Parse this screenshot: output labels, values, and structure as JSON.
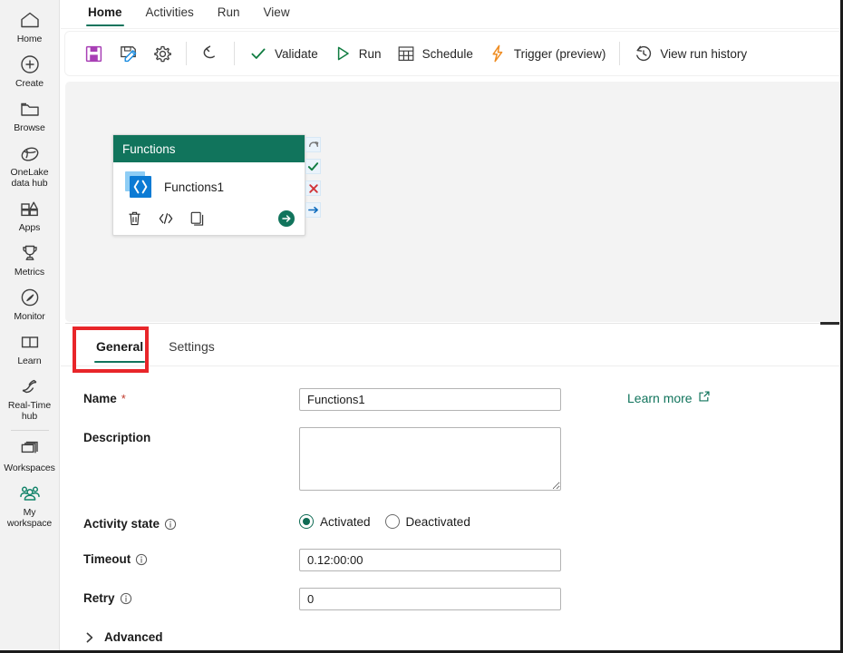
{
  "app": {
    "accent": "#11745c",
    "annotation_color": "#e8262a"
  },
  "rail": {
    "items": [
      {
        "label": "Home",
        "icon": "home-icon"
      },
      {
        "label": "Create",
        "icon": "plus-circle-icon"
      },
      {
        "label": "Browse",
        "icon": "folder-icon"
      },
      {
        "label": "OneLake\ndata hub",
        "label_line1": "OneLake",
        "label_line2": "data hub",
        "icon": "onelake-icon"
      },
      {
        "label": "Apps",
        "icon": "apps-icon"
      },
      {
        "label": "Metrics",
        "icon": "trophy-icon"
      },
      {
        "label": "Monitor",
        "icon": "monitor-icon"
      },
      {
        "label": "Learn",
        "icon": "book-icon"
      },
      {
        "label": "Real-Time\nhub",
        "label_line1": "Real-Time",
        "label_line2": "hub",
        "icon": "realtime-hub-icon"
      },
      {
        "label": "Workspaces",
        "icon": "workspaces-icon"
      },
      {
        "label": "My\nworkspace",
        "label_line1": "My",
        "label_line2": "workspace",
        "icon": "my-workspace-icon"
      }
    ]
  },
  "ribbon": {
    "tabs": [
      {
        "label": "Home",
        "active": true
      },
      {
        "label": "Activities",
        "active": false
      },
      {
        "label": "Run",
        "active": false
      },
      {
        "label": "View",
        "active": false
      }
    ],
    "buttons": [
      {
        "label": "",
        "icon": "save-icon",
        "name": "save-button"
      },
      {
        "label": "",
        "icon": "save-as-icon",
        "name": "save-as-button"
      },
      {
        "label": "",
        "icon": "gear-icon",
        "name": "settings-button"
      },
      {
        "label": "",
        "icon": "undo-icon",
        "name": "undo-button"
      },
      {
        "label": "Validate",
        "icon": "checkmark-icon",
        "name": "validate-button"
      },
      {
        "label": "Run",
        "icon": "play-icon",
        "name": "run-button"
      },
      {
        "label": "Schedule",
        "icon": "calendar-icon",
        "name": "schedule-button"
      },
      {
        "label": "Trigger (preview)",
        "icon": "lightning-icon",
        "name": "trigger-button"
      },
      {
        "label": "View run history",
        "icon": "history-icon",
        "name": "view-run-history-button"
      }
    ],
    "validate_label": "Validate",
    "run_label": "Run",
    "schedule_label": "Schedule",
    "trigger_label": "Trigger (preview)",
    "history_label": "View run history"
  },
  "canvas": {
    "node": {
      "header": "Functions",
      "title": "Functions1",
      "actions": [
        {
          "name": "delete-activity-icon",
          "glyph": "trash"
        },
        {
          "name": "code-view-icon",
          "glyph": "code"
        },
        {
          "name": "duplicate-activity-icon",
          "glyph": "copy"
        }
      ],
      "go_icon": "arrow-right-circle-icon"
    },
    "connectors": [
      {
        "name": "on-skip-connector",
        "icon": "loop-arrow-icon",
        "color": "#6b6b6b"
      },
      {
        "name": "on-success-connector",
        "icon": "checkmark-icon",
        "color": "#107c41"
      },
      {
        "name": "on-fail-connector",
        "icon": "cross-icon",
        "color": "#d13438"
      },
      {
        "name": "on-completion-connector",
        "icon": "arrow-right-icon",
        "color": "#0f6cbd"
      }
    ]
  },
  "panel": {
    "tabs": [
      {
        "label": "General",
        "active": true,
        "highlighted": true
      },
      {
        "label": "Settings",
        "active": false,
        "highlighted": false
      }
    ],
    "fields": {
      "name_label": "Name",
      "name_required_marker": "*",
      "name_value": "Functions1",
      "name_placeholder": "",
      "learn_more_label": "Learn more",
      "description_label": "Description",
      "description_value": "",
      "description_placeholder": "",
      "activity_state_label": "Activity state",
      "activity_state_options": [
        {
          "label": "Activated",
          "selected": true
        },
        {
          "label": "Deactivated",
          "selected": false
        }
      ],
      "timeout_label": "Timeout",
      "timeout_value": "0.12:00:00",
      "retry_label": "Retry",
      "retry_value": "0",
      "advanced_label": "Advanced"
    }
  }
}
